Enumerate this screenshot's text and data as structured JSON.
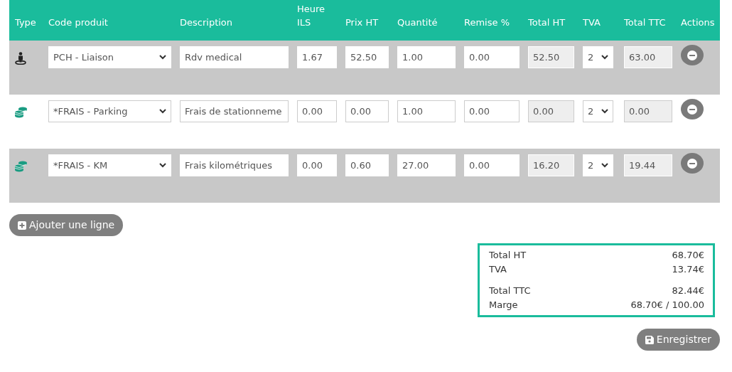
{
  "table": {
    "columns": [
      "Type",
      [
        "Code produit"
      ],
      "Description",
      "Heure ILS",
      "Prix HT",
      "Quantité",
      "Remise %",
      "Total HT",
      "TVA",
      "Total TTC",
      "Actions"
    ],
    "rows": [
      {
        "kind": "person",
        "code": "PCH - Liaison",
        "description": "Rdv medical",
        "heure_ils": "1.67",
        "prix_ht": "52.50",
        "quantite": "1.00",
        "remise": "0.00",
        "total_ht": "52.50",
        "tva": "2",
        "total_ttc": "63.00"
      },
      {
        "kind": "coins",
        "code": "*FRAIS - Parking",
        "description": "Frais de stationneme",
        "heure_ils": "0.00",
        "prix_ht": "0.00",
        "quantite": "1.00",
        "remise": "0.00",
        "total_ht": "0.00",
        "tva": "2",
        "total_ttc": "0.00"
      },
      {
        "kind": "coins",
        "code": "*FRAIS - KM",
        "description": "Frais kilométriques",
        "heure_ils": "0.00",
        "prix_ht": "0.60",
        "quantite": "27.00",
        "remise": "0.00",
        "total_ht": "16.20",
        "tva": "2",
        "total_ttc": "19.44"
      }
    ]
  },
  "add_button": "Ajouter une ligne",
  "totals": [
    {
      "label": "Total HT",
      "value": "68.70€"
    },
    {
      "label": "TVA",
      "value": "13.74€"
    },
    {
      "label": "Total TTC",
      "value": "82.44€"
    },
    {
      "label": "Marge",
      "value": "68.70€ / 100.00"
    }
  ],
  "save_button": "Enregistrer"
}
